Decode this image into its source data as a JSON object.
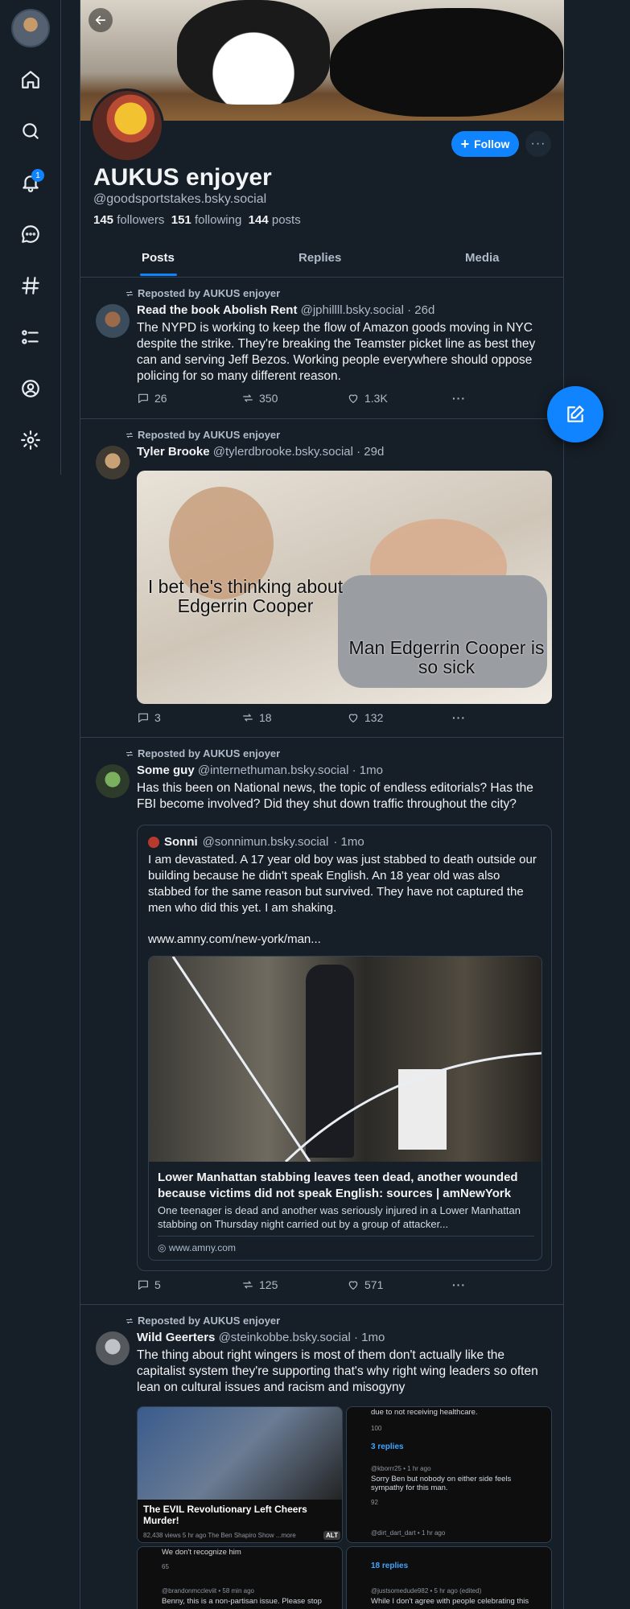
{
  "sidebar": {
    "notification_count": "1"
  },
  "profile": {
    "display_name": "AUKUS enjoyer",
    "handle": "@goodsportstakes.bsky.social",
    "followers_count": "145",
    "followers_label": "followers",
    "following_count": "151",
    "following_label": "following",
    "posts_count": "144",
    "posts_label": "posts",
    "follow_label": "Follow"
  },
  "tabs": [
    "Posts",
    "Replies",
    "Media"
  ],
  "posts": [
    {
      "repost_label": "Reposted by AUKUS enjoyer",
      "author": "Read the book Abolish Rent",
      "handle": "@jphillll.bsky.social",
      "time": "· 26d",
      "text": "The NYPD is working to keep the flow of Amazon goods moving in NYC despite the strike. They're breaking the Teamster picket line as best they can and serving Jeff Bezos. Working people everywhere should oppose policing for so many different reason.",
      "replies": "26",
      "reposts": "350",
      "likes": "1.3K"
    },
    {
      "repost_label": "Reposted by AUKUS enjoyer",
      "author": "Tyler Brooke",
      "handle": "@tylerdbrooke.bsky.social",
      "time": "· 29d",
      "meme_text_1": "I bet he's thinking about Edgerrin Cooper",
      "meme_text_2": "Man Edgerrin Cooper is so sick",
      "replies": "3",
      "reposts": "18",
      "likes": "132"
    },
    {
      "repost_label": "Reposted by AUKUS enjoyer",
      "author": "Some guy",
      "handle": "@internethuman.bsky.social",
      "time": "· 1mo",
      "text": "Has this been on National news, the topic of endless editorials? Has the FBI become involved? Did they shut down traffic throughout the city?",
      "quote": {
        "author": "Sonni",
        "handle": "@sonnimun.bsky.social",
        "time": "· 1mo",
        "text": "I am devastated.  A 17 year old boy was just stabbed to death outside our building because he didn't speak English.  An 18 year old was also stabbed for the same reason but survived.  They have not captured the men who did this yet. I am shaking.",
        "link": "www.amny.com/new-york/man...",
        "card_title": "Lower Manhattan stabbing leaves teen dead, another wounded because victims did not speak English: sources | amNewYork",
        "card_desc": "One teenager is dead and another was seriously injured in a Lower Manhattan stabbing on Thursday night carried out by a group of attacker...",
        "card_domain": "www.amny.com"
      },
      "replies": "5",
      "reposts": "125",
      "likes": "571"
    },
    {
      "repost_label": "Reposted by AUKUS enjoyer",
      "author": "Wild Geerters",
      "handle": "@steinkobbe.bsky.social",
      "time": "· 1mo",
      "text": "The thing about right wingers is most of them don't actually like the capitalist system they're supporting that's why right wing leaders so often lean on cultural issues and racism and misogyny",
      "collage": {
        "video_title": "The EVIL Revolutionary Left Cheers Murder!",
        "video_meta": "82,438 views  5 hr ago  The Ben Shapiro Show  ...more",
        "alt_badge": "ALT",
        "c2_top": "due to not receiving healthcare.",
        "c2_likes": "100",
        "c2_replies": "3 replies",
        "c2_user": "@kborrr25 • 1 hr ago",
        "c2_comment": "Sorry Ben but nobody on either side feels sympathy for this man.",
        "c2_likes2": "92",
        "c2_user2": "@dirt_dart_dart • 1 hr ago",
        "c3_top": "We don't recognize him",
        "c3_likes": "65",
        "c3_user": "@brandonmccleviit • 58 min ago",
        "c3_comment": "Benny, this is a non-partisan issue. Please stop",
        "c4_replies": "18 replies",
        "c4_user": "@justsomedude982 • 5 hr ago (edited)",
        "c4_comment": "While I don't agree with people celebrating this"
      }
    }
  ]
}
